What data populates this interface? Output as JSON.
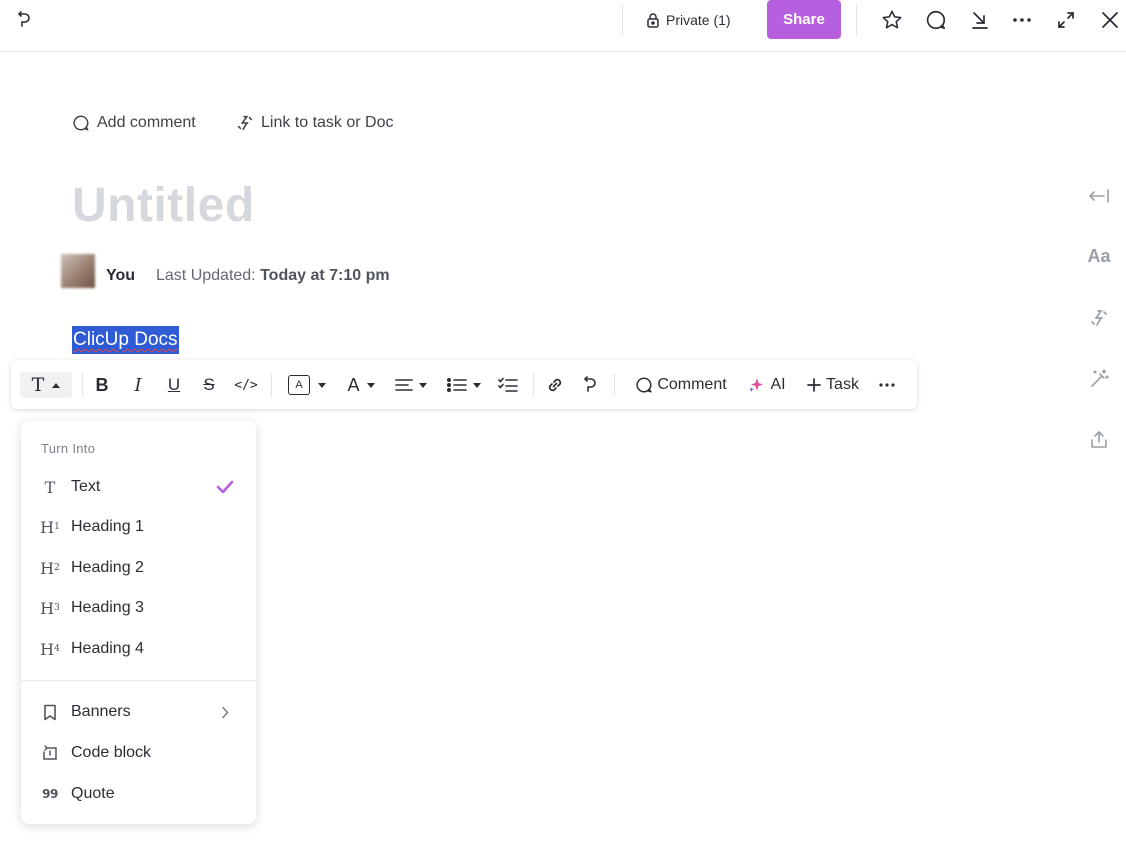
{
  "topbar": {
    "private_label": "Private (1)",
    "share_label": "Share"
  },
  "meta": {
    "add_comment_label": "Add comment",
    "link_label": "Link to task or Doc"
  },
  "doc": {
    "title": "Untitled",
    "author": "You",
    "last_updated_label": "Last Updated:",
    "last_updated_value": "Today at 7:10 pm",
    "selected_text": "ClicUp Docs"
  },
  "toolbar": {
    "text_style_glyph": "T",
    "bold_glyph": "B",
    "italic_glyph": "I",
    "underline_glyph": "U",
    "strike_glyph": "S",
    "code_glyph": "</>",
    "highlight_glyph": "A",
    "text_color_glyph": "A",
    "comment_label": "Comment",
    "ai_label": "AI",
    "task_label": "Task"
  },
  "menu": {
    "header": "Turn Into",
    "items": [
      {
        "label": "Text",
        "icon": "T",
        "selected": true
      },
      {
        "label": "Heading 1",
        "icon": "H",
        "sub": "1"
      },
      {
        "label": "Heading 2",
        "icon": "H",
        "sub": "2"
      },
      {
        "label": "Heading 3",
        "icon": "H",
        "sub": "3"
      },
      {
        "label": "Heading 4",
        "icon": "H",
        "sub": "4"
      }
    ],
    "extra_items": [
      {
        "label": "Banners",
        "icon": "bookmark-icon",
        "has_submenu": true
      },
      {
        "label": "Code block",
        "icon": "code-block-icon"
      },
      {
        "label": "Quote",
        "icon": "99"
      }
    ]
  },
  "rail": {
    "font_glyph": "Aa"
  },
  "colors": {
    "accent": "#b660e0",
    "selection": "#2f5bd4",
    "title_placeholder": "#d5d8dd"
  }
}
